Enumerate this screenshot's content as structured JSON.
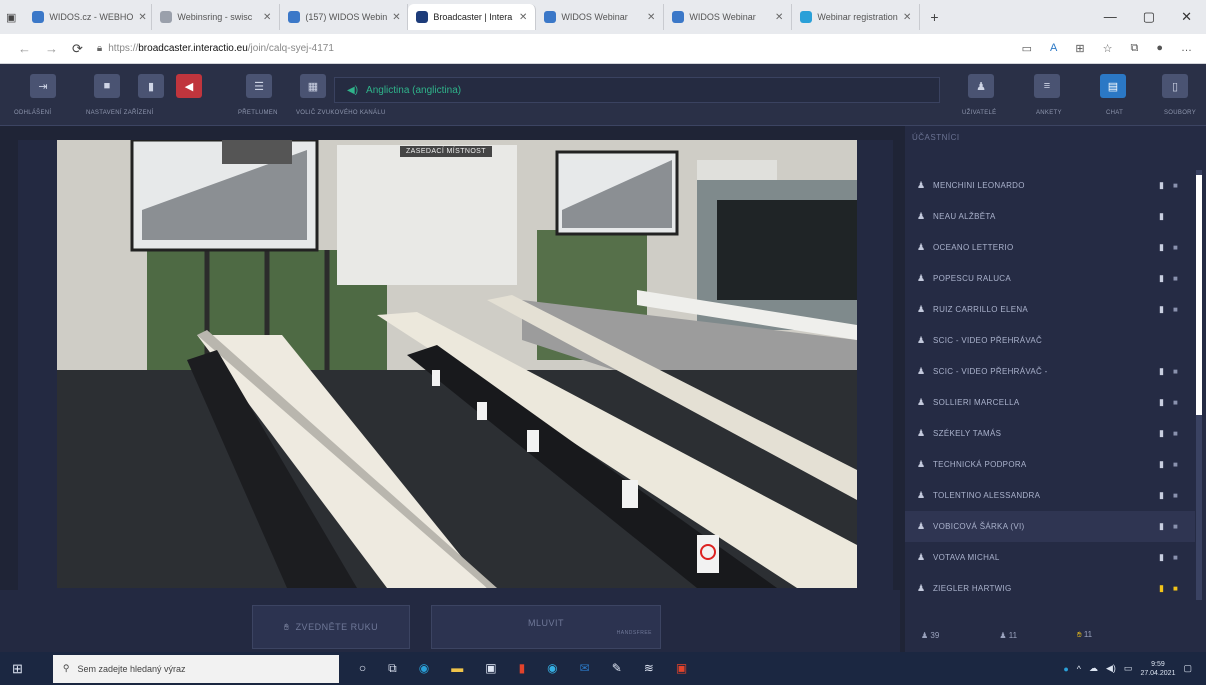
{
  "browser": {
    "tabs": [
      {
        "label": "WIDOS.cz - WEBHO"
      },
      {
        "label": "Webinsring - swisc"
      },
      {
        "label": "(157) WIDOS Webin"
      },
      {
        "label": "Broadcaster | Intera"
      },
      {
        "label": "WIDOS Webinar"
      },
      {
        "label": "WIDOS Webinar"
      },
      {
        "label": "Webinar registration"
      }
    ],
    "active_tab_index": 3,
    "new_tab": "+",
    "window_controls": [
      "—",
      "▢",
      "✕"
    ],
    "url_scheme": "https://",
    "url_host": "broadcaster.interactio.eu",
    "url_path": "/join/calq-syej-4171"
  },
  "toolbar": {
    "labels": {
      "odhlaseni": "ODHLÁŠENÍ",
      "nastaveni": "NASTAVENÍ ZAŘÍZENÍ",
      "prepinac": "PŘETLUMEN",
      "volic": "VOLIČ ZVUKOVÉHO KANÁLU",
      "uzivatele": "UŽIVATELÉ",
      "ankety": "ANKETY",
      "chat": "CHAT",
      "soubory": "SOUBORY"
    },
    "language": "Anglictina (anglictina)"
  },
  "video": {
    "room_label": "ZASEDACÍ MÍSTNOST"
  },
  "actions": {
    "raise_hand": "ZVEDNĚTE RUKU",
    "speak": "MLUVIT",
    "speak_sub": "HANDSFREE"
  },
  "participants": {
    "header": "ÚČASTNÍCI",
    "items": [
      {
        "name": "MENCHINI LEONARDO",
        "mic": true,
        "cam": true
      },
      {
        "name": "NEAU ALŽBĚTA",
        "mic": true,
        "cam": false
      },
      {
        "name": "OCEANO LETTERIO",
        "mic": true,
        "cam": true
      },
      {
        "name": "POPESCU RALUCA",
        "mic": true,
        "cam": true
      },
      {
        "name": "RUIZ CARRILLO ELENA",
        "mic": true,
        "cam": true
      },
      {
        "name": "SCIC - VIDEO PŘEHRÁVAČ",
        "mic": false,
        "cam": false
      },
      {
        "name": "SCIC - VIDEO PŘEHRÁVAČ -",
        "mic": true,
        "cam": true
      },
      {
        "name": "SOLLIERI MARCELLA",
        "mic": true,
        "cam": true
      },
      {
        "name": "SZÉKELY TAMÁS",
        "mic": true,
        "cam": true
      },
      {
        "name": "TECHNICKÁ PODPORA",
        "mic": true,
        "cam": true
      },
      {
        "name": "TOLENTINO ALESSANDRA",
        "mic": true,
        "cam": true
      },
      {
        "name": "VOBICOVÁ ŠÁRKA (VI)",
        "mic": true,
        "cam": true,
        "highlight": true
      },
      {
        "name": "VOTAVA MICHAL",
        "mic": true,
        "cam": true
      },
      {
        "name": "ZIEGLER HARTWIG",
        "mic": true,
        "cam": true,
        "active": true
      }
    ],
    "footer": {
      "total": "39",
      "second": "11",
      "raised": "11"
    }
  },
  "taskbar": {
    "search_placeholder": "Sem zadejte hledaný výraz",
    "time": "9:59",
    "date": "27.04.2021"
  },
  "colors": {
    "accent_blue": "#2b78c5",
    "mute_red": "#c0353d",
    "active_yellow": "#f3c419",
    "language_green": "#2fb38a"
  }
}
